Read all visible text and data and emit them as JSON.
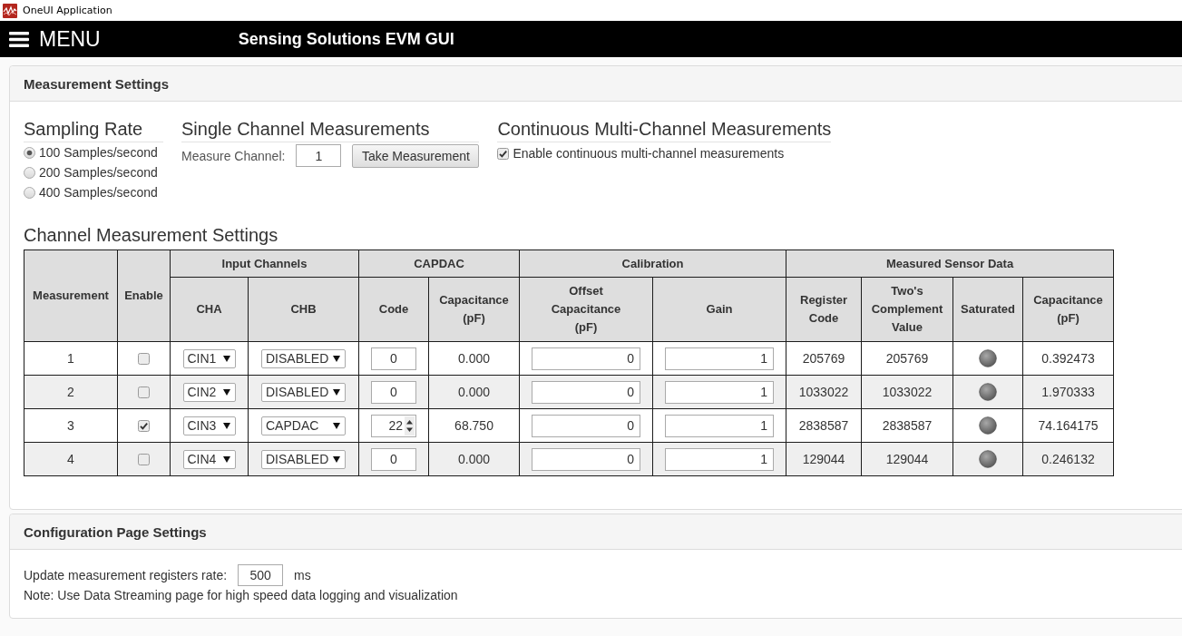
{
  "window": {
    "title": "OneUI Application"
  },
  "header": {
    "menu_label": "MENU",
    "title": "Sensing Solutions EVM GUI"
  },
  "measurement_settings": {
    "title": "Measurement Settings",
    "sampling_rate": {
      "title": "Sampling Rate",
      "options": [
        {
          "label": "100 Samples/second",
          "selected": true
        },
        {
          "label": "200 Samples/second",
          "selected": false
        },
        {
          "label": "400 Samples/second",
          "selected": false
        }
      ]
    },
    "single_channel": {
      "title": "Single Channel Measurements",
      "field_label": "Measure Channel:",
      "value": "1",
      "button": "Take Measurement"
    },
    "continuous": {
      "title": "Continuous Multi-Channel Measurements",
      "checkbox_label": "Enable continuous multi-channel measurements",
      "checked": true
    },
    "channel_table": {
      "title": "Channel Measurement Settings",
      "columns": [
        {
          "label": "Measurement"
        },
        {
          "label": "Enable"
        },
        {
          "label": "Input Channels",
          "children": [
            {
              "label": "CHA"
            },
            {
              "label": "CHB"
            }
          ]
        },
        {
          "label": "CAPDAC",
          "children": [
            {
              "label": "Code"
            },
            {
              "label": "Capacitance (pF)"
            }
          ]
        },
        {
          "label": "Calibration",
          "children": [
            {
              "label": "Offset Capacitance (pF)"
            },
            {
              "label": "Gain"
            }
          ]
        },
        {
          "label": "Measured Sensor Data",
          "children": [
            {
              "label": "Register Code"
            },
            {
              "label": "Two's Complement Value"
            },
            {
              "label": "Saturated"
            },
            {
              "label": "Capacitance (pF)"
            }
          ]
        }
      ],
      "rows": [
        {
          "measurement": "1",
          "enabled": false,
          "cha": "CIN1",
          "chb": "DISABLED",
          "capdac_code": "0",
          "show_spinner": false,
          "capdac_capacitance": "0.000",
          "offset_capacitance": "0",
          "gain": "1",
          "register_code": "205769",
          "twos_complement": "205769",
          "saturated": false,
          "capacitance": "0.392473"
        },
        {
          "measurement": "2",
          "enabled": false,
          "cha": "CIN2",
          "chb": "DISABLED",
          "capdac_code": "0",
          "show_spinner": false,
          "capdac_capacitance": "0.000",
          "offset_capacitance": "0",
          "gain": "1",
          "register_code": "1033022",
          "twos_complement": "1033022",
          "saturated": false,
          "capacitance": "1.970333"
        },
        {
          "measurement": "3",
          "enabled": true,
          "cha": "CIN3",
          "chb": "CAPDAC",
          "capdac_code": "22",
          "show_spinner": true,
          "capdac_capacitance": "68.750",
          "offset_capacitance": "0",
          "gain": "1",
          "register_code": "2838587",
          "twos_complement": "2838587",
          "saturated": false,
          "capacitance": "74.164175"
        },
        {
          "measurement": "4",
          "enabled": false,
          "cha": "CIN4",
          "chb": "DISABLED",
          "capdac_code": "0",
          "show_spinner": false,
          "capdac_capacitance": "0.000",
          "offset_capacitance": "0",
          "gain": "1",
          "register_code": "129044",
          "twos_complement": "129044",
          "saturated": false,
          "capacitance": "0.246132"
        }
      ]
    }
  },
  "configuration": {
    "title": "Configuration Page Settings",
    "rate_label": "Update measurement registers rate:",
    "rate_value": "500",
    "rate_unit": "ms",
    "note": "Note: Use Data Streaming page for high speed data logging and visualization"
  }
}
